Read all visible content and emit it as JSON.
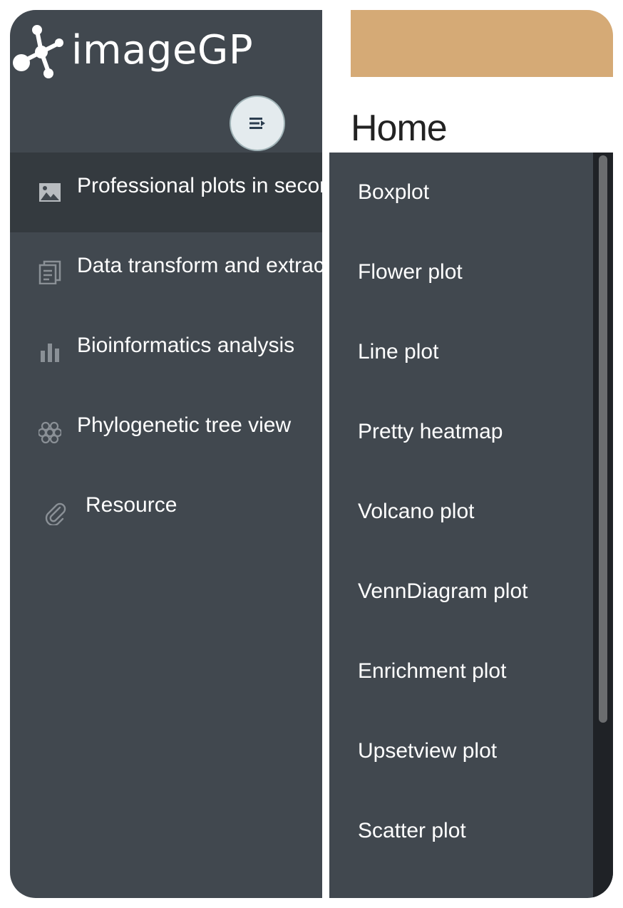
{
  "app": {
    "logo_text": "imageGP"
  },
  "toggle": {
    "icon": "menu-collapse-icon"
  },
  "sidebar": {
    "items": [
      {
        "label": "Professional plots in seconds",
        "icon": "image-icon",
        "active": true
      },
      {
        "label": "Data transform and extraction",
        "icon": "documents-icon",
        "active": false
      },
      {
        "label": "Bioinformatics analysis",
        "icon": "bar-chart-icon",
        "active": false
      },
      {
        "label": "Phylogenetic tree view",
        "icon": "grapes-icon",
        "active": false
      },
      {
        "label": "Resource",
        "icon": "paperclip-icon",
        "active": false
      }
    ]
  },
  "main": {
    "title": "Home"
  },
  "submenu": {
    "items": [
      {
        "label": "Boxplot"
      },
      {
        "label": "Flower plot"
      },
      {
        "label": "Line plot"
      },
      {
        "label": "Pretty heatmap"
      },
      {
        "label": "Volcano plot"
      },
      {
        "label": "VennDiagram plot"
      },
      {
        "label": "Enrichment plot"
      },
      {
        "label": "Upsetview plot"
      },
      {
        "label": "Scatter plot"
      }
    ]
  },
  "colors": {
    "sidebar_bg": "#41484f",
    "active_item_bg": "#343a3f",
    "banner": "#d5aa76",
    "scroll_track": "#1f2226"
  }
}
